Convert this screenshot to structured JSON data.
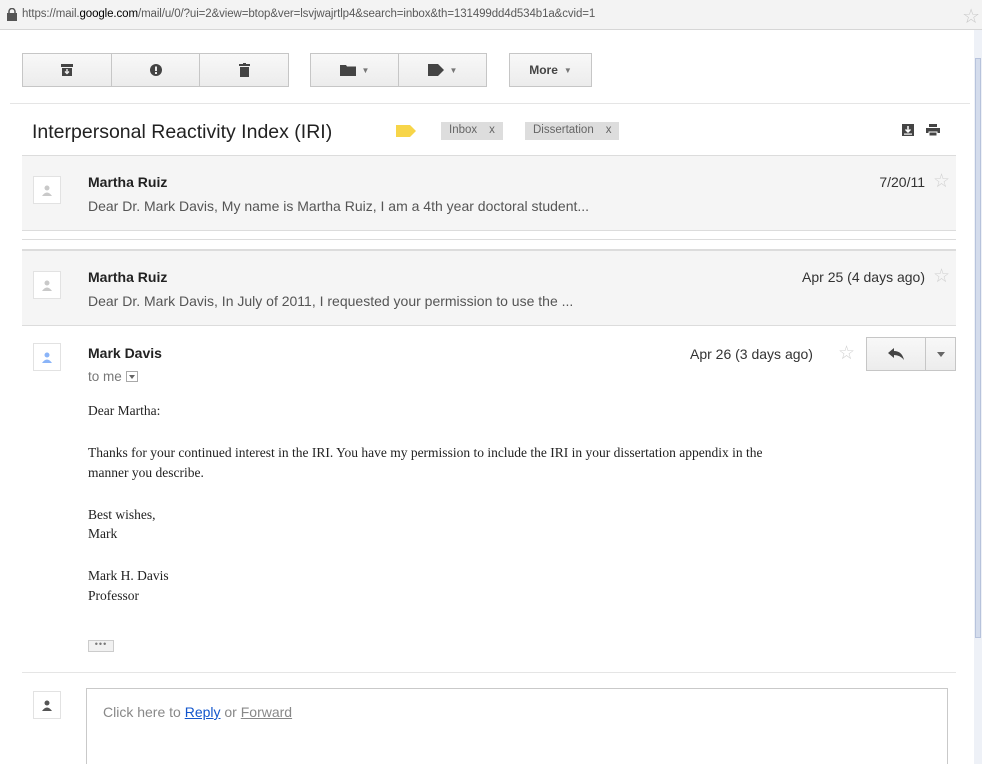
{
  "browser": {
    "url_prefix": "https://mail.",
    "url_host": "google.com",
    "url_rest": "/mail/u/0/?ui=2&view=btop&ver=lsvjwajrtlp4&search=inbox&th=131499dd4d534b1a&cvid=1"
  },
  "toolbar": {
    "more_label": "More"
  },
  "thread": {
    "subject": "Interpersonal Reactivity Index (IRI)",
    "label_color": "#f7d549",
    "chips": [
      {
        "label": "Inbox",
        "close": "x"
      },
      {
        "label": "Dissertation",
        "close": "x"
      }
    ]
  },
  "messages": [
    {
      "sender": "Martha Ruiz",
      "snippet": "Dear Dr. Mark Davis, My name is Martha Ruiz, I am a 4th year doctoral student...",
      "date": "7/20/11"
    },
    {
      "sender": "Martha Ruiz",
      "snippet": "Dear Dr. Mark Davis, In July of 2011, I requested your permission to use the ...",
      "date": "Apr 25 (4 days ago)"
    }
  ],
  "expanded": {
    "sender": "Mark Davis",
    "recipient": "to me",
    "date": "Apr 26 (3 days ago)",
    "body": {
      "greeting": "Dear Martha:",
      "para1_line1": "Thanks for your continued interest in the IRI.  You have my permission to include the IRI in your dissertation appendix in the",
      "para1_line2": "manner you describe.",
      "closing1": "Best wishes,",
      "closing2": "Mark",
      "sig1": "Mark H. Davis",
      "sig2": "Professor"
    },
    "trimmed": "•••"
  },
  "reply_box": {
    "prefix": "Click here to ",
    "reply": "Reply",
    "or": " or ",
    "forward": "Forward"
  },
  "colors": {
    "link": "#1155cc",
    "avatar_active": "#8ab4f8"
  }
}
